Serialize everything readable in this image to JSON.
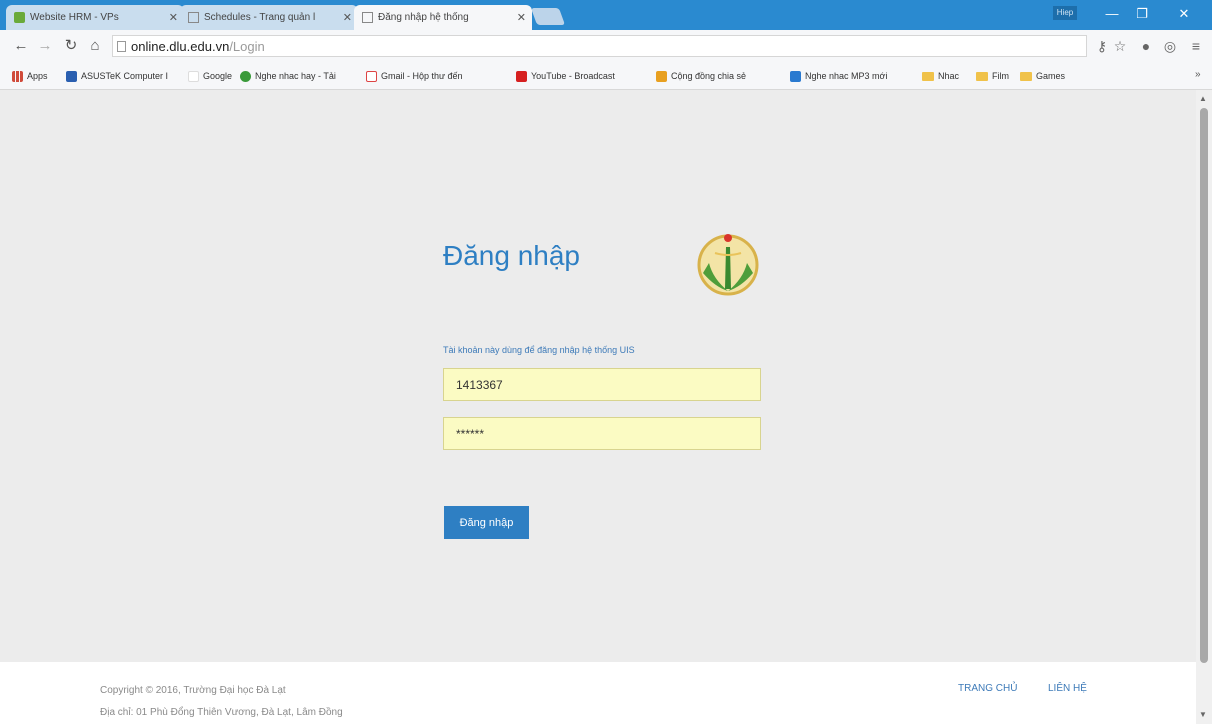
{
  "tabs": [
    {
      "title": "Website HRM - VPs"
    },
    {
      "title": "Schedules - Trang quản l"
    },
    {
      "title": "Đăng nhập hệ thống"
    }
  ],
  "window": {
    "user_badge": "Hiep"
  },
  "address_bar": {
    "host": "online.dlu.edu.vn",
    "path": "/Login"
  },
  "bookmarks": [
    {
      "label": "Apps"
    },
    {
      "label": "ASUSTeK Computer I"
    },
    {
      "label": "Google"
    },
    {
      "label": "Nghe nhac hay - Tải"
    },
    {
      "label": "Gmail - Hộp thư đến"
    },
    {
      "label": "YouTube - Broadcast"
    },
    {
      "label": "Cộng đồng chia sẻ"
    },
    {
      "label": "Nghe nhac MP3 mới"
    },
    {
      "label": "Nhac"
    },
    {
      "label": "Film"
    },
    {
      "label": "Games"
    }
  ],
  "login": {
    "title": "Đăng nhập",
    "hint": "Tài khoản này dùng để đăng nhập hệ thống UIS",
    "username_value": "1413367",
    "password_value": "******",
    "submit_label": "Đăng nhập"
  },
  "footer": {
    "copyright": "Copyright © 2016, Trường Đại học Đà Lạt",
    "address": "Địa chỉ: 01 Phù Đổng Thiên Vương, Đà Lạt, Lâm Đồng",
    "links": [
      {
        "label": "TRANG CHỦ"
      },
      {
        "label": "LIÊN HỆ"
      }
    ]
  },
  "colors": {
    "accent": "#2e7fc3",
    "titlebar": "#2a8ad0",
    "autofill": "#fbfbc3"
  },
  "icons": [
    "back-icon",
    "forward-icon",
    "reload-icon",
    "home-icon",
    "page-icon",
    "star-icon",
    "extension-icon",
    "menu-icon",
    "folder-icon",
    "university-logo"
  ]
}
